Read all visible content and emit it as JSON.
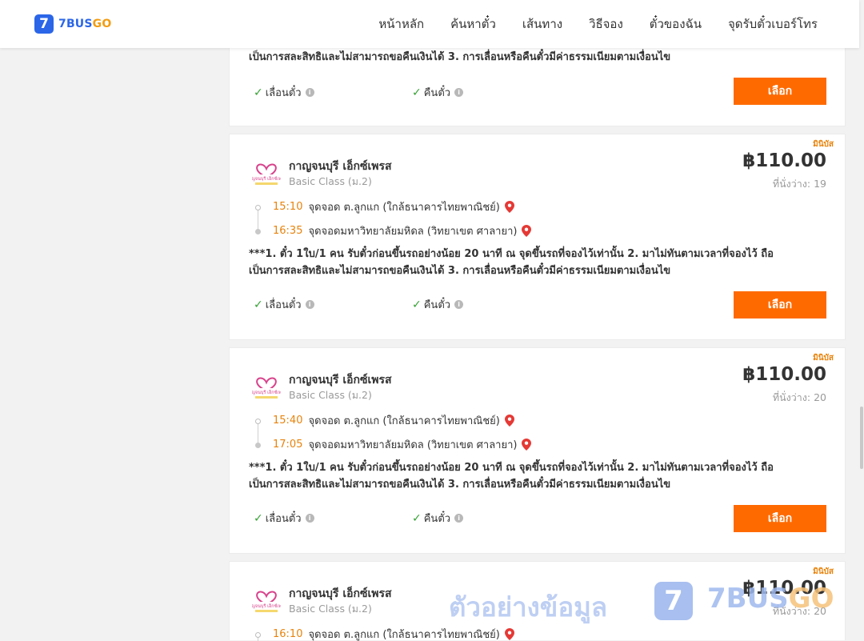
{
  "header": {
    "logo_number": "7",
    "logo_text_main": "7BUS",
    "logo_text_accent": "GO",
    "nav": [
      "หน้าหลัก",
      "ค้นหาตั๋ว",
      "เส้นทาง",
      "วิธีจอง",
      "ตั๋วของฉัน",
      "จุดรับตั๋วเบอร์โทร"
    ]
  },
  "common": {
    "note_line1": "***1. ตั๋ว 1ใบ/1 คน รับตั๋วก่อนขึ้นรถอย่างน้อย 20 นาที ณ จุดขึ้นรถที่จองไว้เท่านั้น 2. มาไม่ทันตามเวลาที่จองไว้ ถือ",
    "note_line2": "เป็นการสละสิทธิและไม่สามารถขอคืนเงินได้ 3. การเลื่อนหรือคืนตั๋วมีค่าธรรมเนียมตามเงื่อนไข",
    "feature_change": "เลื่อนตั๋ว",
    "feature_refund": "คืนตั๋ว",
    "select_label": "เลือก",
    "badge": "มินิบัส",
    "logo_caption": "กาญจนบุรี เอ็กซ์เพรส"
  },
  "trips": [
    {
      "operator": "กาญจนบุรี เอ็กซ์เพรส",
      "class": "Basic Class (ม.2)",
      "price": "฿110.00",
      "seats": "ที่นั่งว่าง: 19",
      "depart_time": "15:10",
      "depart_stop": "จุดจอด ต.ลูกแก (ใกล้ธนาคารไทยพาณิชย์)",
      "arrive_time": "16:35",
      "arrive_stop": "จุดจอดมหาวิทยาลัยมหิดล (วิทยาเขต ศาลายา)"
    },
    {
      "operator": "กาญจนบุรี เอ็กซ์เพรส",
      "class": "Basic Class (ม.2)",
      "price": "฿110.00",
      "seats": "ที่นั่งว่าง: 20",
      "depart_time": "15:40",
      "depart_stop": "จุดจอด ต.ลูกแก (ใกล้ธนาคารไทยพาณิชย์)",
      "arrive_time": "17:05",
      "arrive_stop": "จุดจอดมหาวิทยาลัยมหิดล (วิทยาเขต ศาลายา)"
    },
    {
      "operator": "กาญจนบุรี เอ็กซ์เพรส",
      "class": "Basic Class (ม.2)",
      "price": "฿110.00",
      "seats": "ที่นั่งว่าง: 20",
      "depart_time": "16:10",
      "depart_stop": "จุดจอด ต.ลูกแก (ใกล้ธนาคารไทยพาณิชย์)"
    }
  ],
  "watermark": {
    "text": "ตัวอย่างข้อมูล",
    "brand_main": "7BUS",
    "brand_accent": "GO",
    "mark": "7"
  },
  "colors": {
    "accent_orange": "#ff6a00",
    "time_orange": "#e8830c",
    "brand_blue": "#2b66e8",
    "check_green": "#38a238",
    "pin_red": "#e53935"
  },
  "icons": [
    "check-icon",
    "info-icon",
    "map-pin-icon",
    "heart-logo-icon"
  ]
}
